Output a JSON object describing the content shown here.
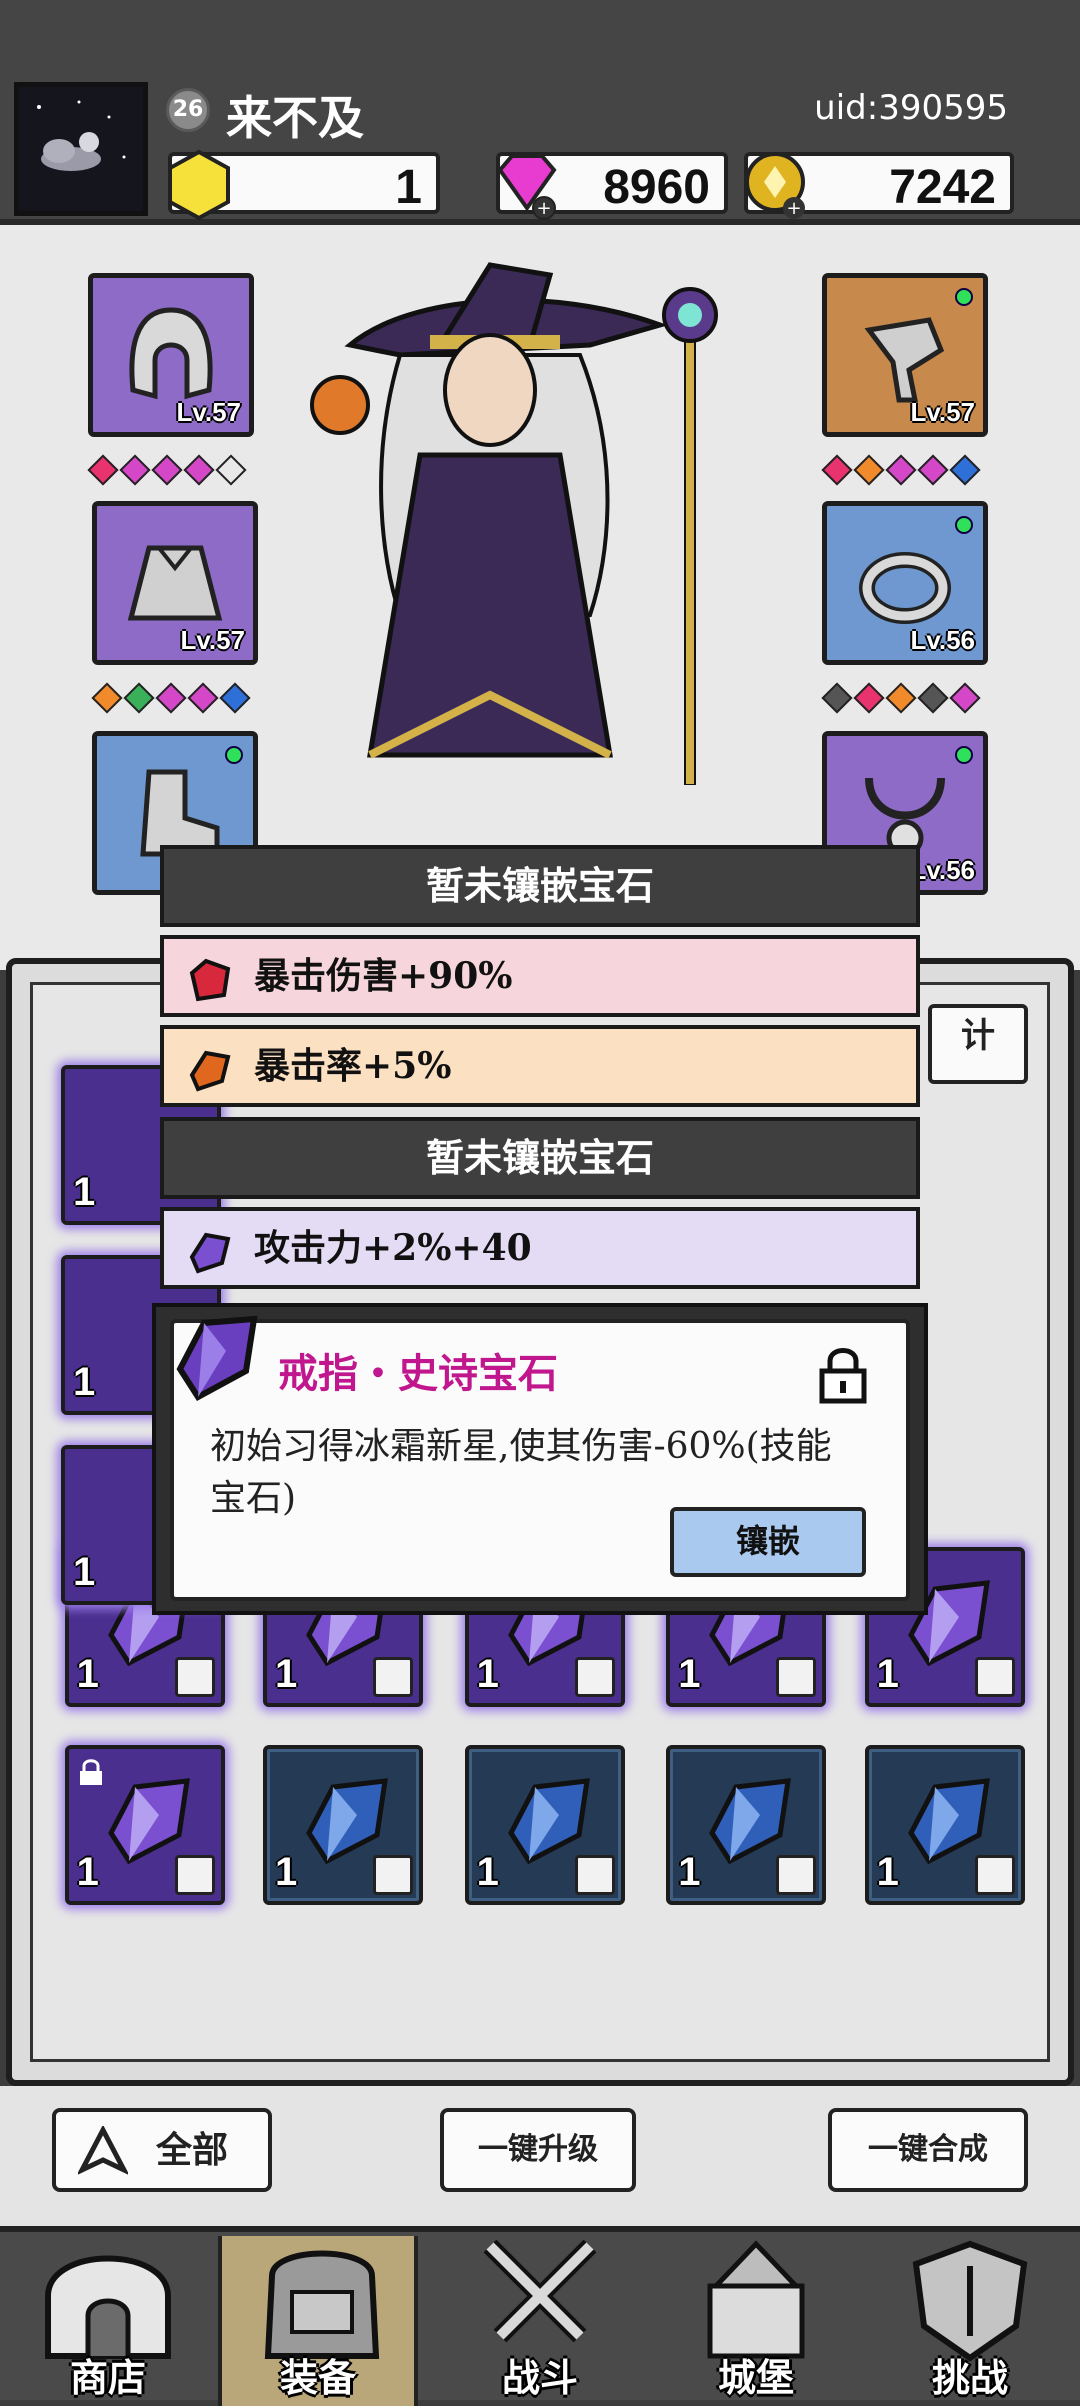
{
  "player": {
    "level": "26",
    "name": "来不及",
    "uid": "uid:390595"
  },
  "resources": [
    {
      "name": "gold-crystal",
      "value": "1",
      "color": "#f6e03a"
    },
    {
      "name": "diamond",
      "value": "8960",
      "color": "#e83bd0"
    },
    {
      "name": "coin",
      "value": "7242",
      "color": "#e0b320"
    }
  ],
  "equipment": {
    "left": [
      {
        "slot": "helmet",
        "level": "Lv.57",
        "rarity": "epic"
      },
      {
        "slot": "armor",
        "level": "Lv.57",
        "rarity": "epic"
      },
      {
        "slot": "boots",
        "level": "",
        "rarity": "rare"
      }
    ],
    "right": [
      {
        "slot": "weapon",
        "level": "Lv.57",
        "rarity": "legendary"
      },
      {
        "slot": "ring",
        "level": "Lv.56",
        "rarity": "rare"
      },
      {
        "slot": "necklace",
        "level": "Lv.56",
        "rarity": "epic"
      }
    ]
  },
  "tooltip": {
    "socket1_empty": "暂未镶嵌宝石",
    "stat1": "暴击伤害+90%",
    "stat2": "暴击率+5%",
    "socket2_empty": "暂未镶嵌宝石",
    "stat3": "攻击力+2%+40",
    "gem_title": "戒指・史诗宝石",
    "gem_desc": "初始习得冰霜新星,使其伤害-60%(技能宝石)",
    "embed_label": "镶嵌"
  },
  "inventory_cells": [
    {
      "qty": "1",
      "rarity": "epic",
      "locked": false
    },
    {
      "qty": "1",
      "rarity": "epic",
      "locked": true
    },
    {
      "qty": "1",
      "rarity": "epic",
      "locked": false
    },
    {
      "qty": "1",
      "rarity": "epic",
      "locked": false
    },
    {
      "qty": "1",
      "rarity": "epic",
      "locked": false
    },
    {
      "qty": "1",
      "rarity": "epic",
      "locked": true
    },
    {
      "qty": "1",
      "rarity": "rare",
      "locked": false
    },
    {
      "qty": "1",
      "rarity": "rare",
      "locked": false
    },
    {
      "qty": "1",
      "rarity": "rare",
      "locked": false
    },
    {
      "qty": "1",
      "rarity": "rare",
      "locked": false
    }
  ],
  "left_column_qty": [
    "1",
    "1",
    "1"
  ],
  "tab_partial": "计",
  "actions": {
    "filter_label": "全部",
    "upgrade_all": "一键升级",
    "merge_all": "一键合成"
  },
  "nav": [
    {
      "label": "商店",
      "icon": "shop-icon"
    },
    {
      "label": "装备",
      "icon": "backpack-icon",
      "active": true
    },
    {
      "label": "战斗",
      "icon": "swords-icon"
    },
    {
      "label": "城堡",
      "icon": "castle-icon"
    },
    {
      "label": "挑战",
      "icon": "shield-icon"
    }
  ]
}
